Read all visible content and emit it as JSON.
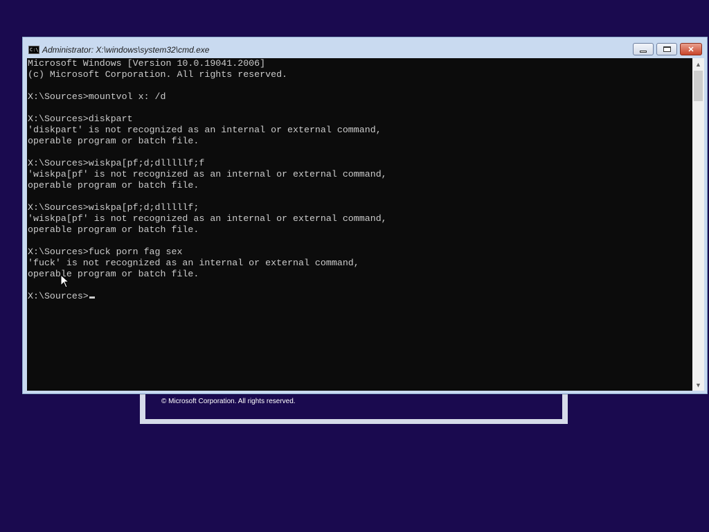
{
  "background": {
    "color": "#1a0a4f",
    "setup_footer": "© Microsoft Corporation. All rights reserved."
  },
  "window": {
    "title": "Administrator: X:\\windows\\system32\\cmd.exe",
    "app_icon": "cmd-icon",
    "buttons": {
      "minimize": "minimize-icon",
      "maximize": "maximize-icon",
      "close": "close-icon"
    }
  },
  "console": {
    "lines": [
      "Microsoft Windows [Version 10.0.19041.2006]",
      "(c) Microsoft Corporation. All rights reserved.",
      "",
      "X:\\Sources>mountvol x: /d",
      "",
      "X:\\Sources>diskpart",
      "'diskpart' is not recognized as an internal or external command,",
      "operable program or batch file.",
      "",
      "X:\\Sources>wiskpa[pf;d;dlllllf;f",
      "'wiskpa[pf' is not recognized as an internal or external command,",
      "operable program or batch file.",
      "",
      "X:\\Sources>wiskpa[pf;d;dlllllf;",
      "'wiskpa[pf' is not recognized as an internal or external command,",
      "operable program or batch file.",
      "",
      "X:\\Sources>fuck porn fag sex",
      "'fuck' is not recognized as an internal or external command,",
      "operable program or batch file.",
      ""
    ],
    "prompt": "X:\\Sources>",
    "text_color": "#cccccc",
    "bg_color": "#0c0c0c"
  },
  "scrollbar": {
    "up_icon": "scroll-up-icon",
    "down_icon": "scroll-down-icon"
  }
}
